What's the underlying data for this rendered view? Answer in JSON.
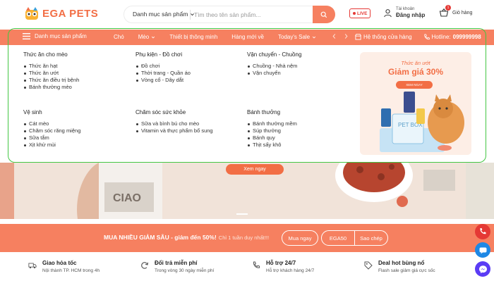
{
  "brand": {
    "name": "EGA PETS",
    "primary": "#f68060",
    "accent": "#f26e45",
    "highlight_border": "#43c643"
  },
  "search": {
    "category_label": "Danh mục sản phẩm",
    "placeholder": "Tìm theo tên sản phẩm...",
    "icon": "search-icon"
  },
  "header": {
    "live_label": "LIVE",
    "account_small": "Tài khoản",
    "account_big": "Đăng nhập",
    "cart_count": "1",
    "cart_label": "Giỏ hàng"
  },
  "nav": {
    "menu_label": "Danh mục sản phẩm",
    "items": [
      {
        "label": "Chó",
        "dropdown": false
      },
      {
        "label": "Mèo",
        "dropdown": true
      },
      {
        "label": "Thiết bị thông minh",
        "dropdown": false
      },
      {
        "label": "Hàng mới về",
        "dropdown": false
      },
      {
        "label": "Today's Sale",
        "dropdown": true
      }
    ],
    "store_label": "Hệ thống cửa hàng",
    "hotline_label": "Hotline:",
    "hotline_number": "099999998"
  },
  "mega_menu": {
    "columns": [
      {
        "title": "Thức ăn cho mèo",
        "items": [
          "Thức ăn hạt",
          "Thức ăn ướt",
          "Thức ăn điều trị bệnh",
          "Bánh thưởng mèo"
        ]
      },
      {
        "title": "Phụ kiện - Đồ chơi",
        "items": [
          "Đồ chơi",
          "Thời trang - Quần áo",
          "Vòng cổ - Dây dắt"
        ]
      },
      {
        "title": "Vận chuyển - Chuồng",
        "items": [
          "Chuồng - Nhà nệm",
          "Vận chuyển"
        ]
      },
      {
        "title": "Vệ sinh",
        "items": [
          "Cát mèo",
          "Chăm sóc răng miệng",
          "Sữa tắm",
          "Xịt khử mùi"
        ]
      },
      {
        "title": "Chăm sóc sức khỏe",
        "items": [
          "Sữa và bình bú cho mèo",
          "Vitamin và thực phẩm bổ sung"
        ]
      },
      {
        "title": "Bánh thưởng",
        "items": [
          "Bánh thưởng mềm",
          "Súp thưởng",
          "Bánh quy",
          "Thịt sấy khô"
        ]
      }
    ],
    "promo": {
      "line1": "Thức ăn ướt",
      "line2": "Giảm giá 30%",
      "button": "XEM NGAY",
      "box_text": "PET BOX"
    }
  },
  "hero": {
    "button": "Xem ngay"
  },
  "strip": {
    "headline": "MUA NHIỀU GIẢM SÂU - giảm đến 50%!",
    "sub": "Chỉ 1 tuần duy nhất!!!",
    "buy_button": "Mua ngay",
    "coupon_code": "EGA50",
    "copy_button": "Sao chép"
  },
  "features": [
    {
      "icon": "truck-icon",
      "title": "Giao hỏa tốc",
      "sub": "Nội thành TP. HCM trong 4h"
    },
    {
      "icon": "refresh-icon",
      "title": "Đổi trả miễn phí",
      "sub": "Trong vòng 30 ngày miễn phí"
    },
    {
      "icon": "phone-support-icon",
      "title": "Hỗ trợ 24/7",
      "sub": "Hỗ trợ khách hàng 24/7"
    },
    {
      "icon": "tag-icon",
      "title": "Deal hot bùng nổ",
      "sub": "Flash sale giảm giá cực sốc"
    }
  ],
  "floating": [
    {
      "icon": "phone-icon",
      "color": "#e53935"
    },
    {
      "icon": "zalo-icon",
      "color": "#1e88e5"
    },
    {
      "icon": "messenger-icon",
      "color": "#5b3cf5"
    }
  ]
}
